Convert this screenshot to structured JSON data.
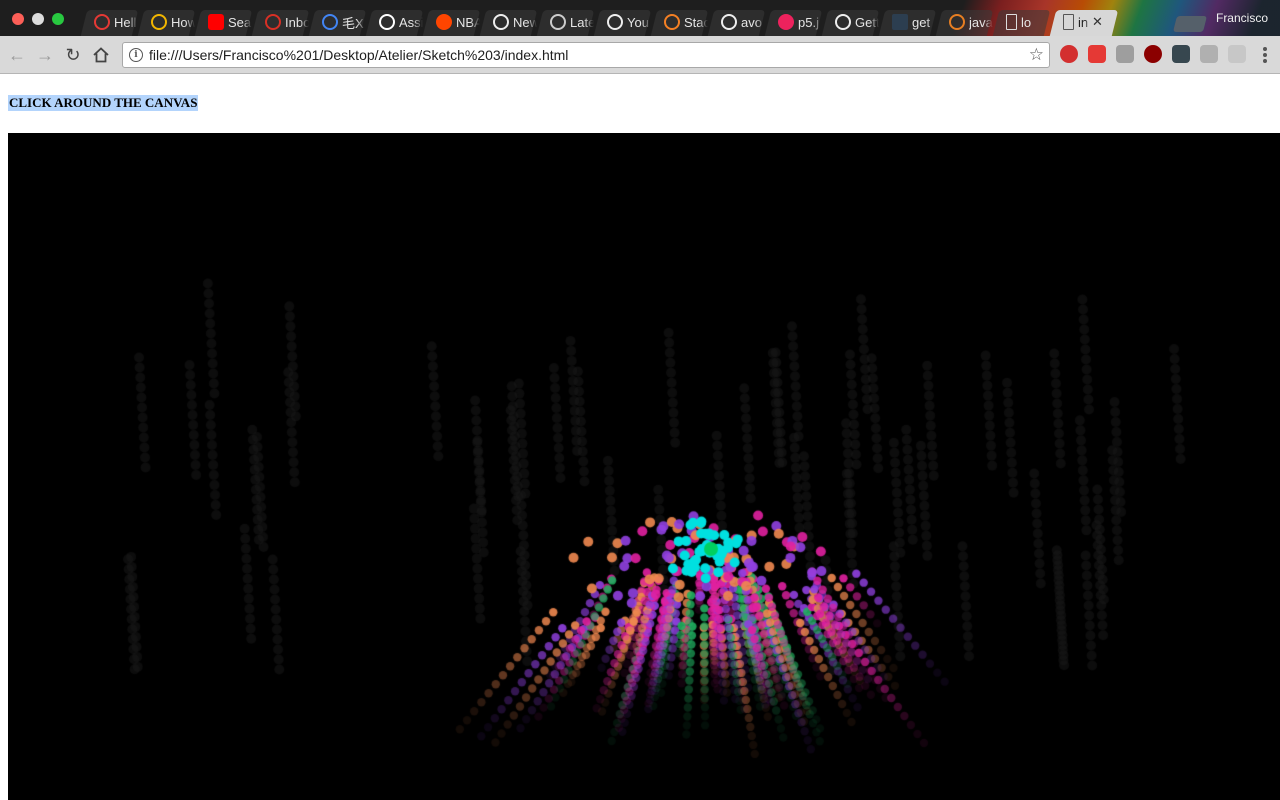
{
  "window": {
    "profile_name": "Francisco",
    "tabs": [
      {
        "title": "Hell",
        "icon": "opera-ring-icon",
        "color": "#e53935"
      },
      {
        "title": "How",
        "icon": "globe-icon",
        "color": "#f2b600"
      },
      {
        "title": "Sea",
        "icon": "youtube-icon",
        "color": "#ff0000"
      },
      {
        "title": "Inbo",
        "icon": "gmail-icon",
        "color": "#d93025"
      },
      {
        "title": "毛X",
        "icon": "google-icon",
        "color": "#4285f4"
      },
      {
        "title": "Assi",
        "icon": "assignment-icon",
        "color": "#ffffff"
      },
      {
        "title": "NBA",
        "icon": "reddit-icon",
        "color": "#ff4500"
      },
      {
        "title": "New",
        "icon": "circle-dot-icon",
        "color": "#eeeeee"
      },
      {
        "title": "Late",
        "icon": "quora-icon",
        "color": "#cccccc"
      },
      {
        "title": "You",
        "icon": "github-icon",
        "color": "#eeeeee"
      },
      {
        "title": "Stac",
        "icon": "stackoverflow-icon",
        "color": "#f48024"
      },
      {
        "title": "avo",
        "icon": "github-icon",
        "color": "#eeeeee"
      },
      {
        "title": "p5.j",
        "icon": "p5-star-icon",
        "color": "#ed225d"
      },
      {
        "title": "Gett",
        "icon": "github-icon",
        "color": "#eeeeee"
      },
      {
        "title": "get",
        "icon": "pinboard-icon",
        "color": "#2c3e50"
      },
      {
        "title": "java",
        "icon": "pencil-icon",
        "color": "#e67e22"
      },
      {
        "title": "lo",
        "icon": "document-icon",
        "color": "#dddddd"
      },
      {
        "title": "in",
        "icon": "document-icon",
        "color": "#555555"
      }
    ],
    "active_tab": 17
  },
  "toolbar": {
    "url": "file:///Users/Francisco%201/Desktop/Atelier/Sketch%203/index.html",
    "extensions": [
      {
        "name": "adblock-icon",
        "color": "#d32f2f"
      },
      {
        "name": "pocket-icon",
        "color": "#e53935"
      },
      {
        "name": "translate-icon",
        "color": "#9e9e9e"
      },
      {
        "name": "ublock-icon",
        "color": "#8b0000"
      },
      {
        "name": "dark-reader-icon",
        "color": "#37474f"
      },
      {
        "name": "extension-icon",
        "color": "#b0b0b0"
      },
      {
        "name": "cast-icon",
        "color": "#c7c7c7"
      }
    ]
  },
  "page": {
    "instruction": "CLICK AROUND THE CANVAS",
    "canvas_background": "#000000",
    "particle_colors": [
      "#00e0e0",
      "#f08850",
      "#9040e0",
      "#e020a0",
      "#20b060",
      "#00d060"
    ]
  }
}
